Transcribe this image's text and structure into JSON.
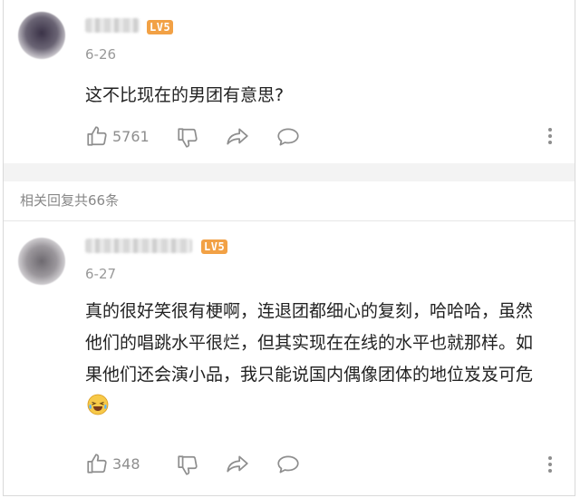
{
  "comment": {
    "level_badge": "LV5",
    "date": "6-26",
    "text": "这不比现在的男团有意思?",
    "like_count": "5761"
  },
  "replies_summary": "相关回复共66条",
  "reply": {
    "level_badge": "LV5",
    "date": "6-27",
    "text": "真的很好笑很有梗啊，连退团都细心的复刻，哈哈哈，虽然他们的唱跳水平很烂，但其实现在在线的水平也就那样。如果他们还会演小品，我只能说国内偶像团体的地位岌岌可危",
    "like_count": "348"
  },
  "colors": {
    "badge": "#f2a145",
    "secondary_text": "#999999",
    "icon": "#8e8e8e",
    "divider": "#f3f3f3"
  },
  "icons": [
    "thumbs-up-icon",
    "thumbs-down-icon",
    "share-icon",
    "comment-icon",
    "more-vertical-icon",
    "laughing-tears-emoji"
  ]
}
